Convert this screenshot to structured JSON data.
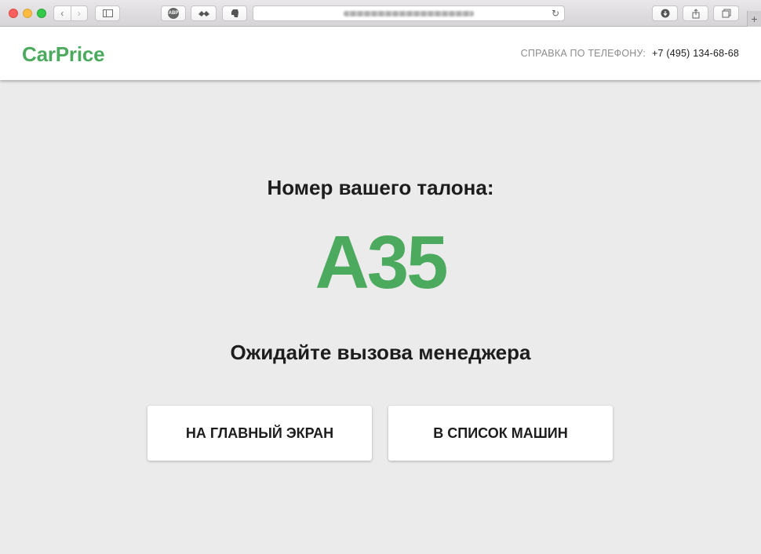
{
  "browser": {
    "icons": {
      "back": "chevron-left-icon",
      "forward": "chevron-right-icon",
      "sidebar": "sidebar-icon",
      "adblock": "adblock-icon",
      "extension": "extension-icon",
      "evernote": "evernote-icon",
      "reload": "reload-icon",
      "download": "download-icon",
      "share": "share-icon",
      "tabs": "tabs-icon",
      "new_tab": "plus-icon"
    },
    "adblock_label": "ABP"
  },
  "header": {
    "logo": "CarPrice",
    "phone_label": "СПРАВКА ПО ТЕЛЕФОНУ:",
    "phone_number": "+7 (495) 134-68-68"
  },
  "main": {
    "ticket_title": "Номер вашего талона:",
    "ticket_number": "A35",
    "wait_text": "Ожидайте вызова менеджера",
    "buttons": {
      "home": "НА ГЛАВНЫЙ ЭКРАН",
      "cars": "В СПИСОК МАШИН"
    }
  },
  "colors": {
    "brand_green": "#4caa5f",
    "background": "#ebebeb",
    "text_dark": "#1d1d1d",
    "text_muted": "#8c8c8c"
  }
}
